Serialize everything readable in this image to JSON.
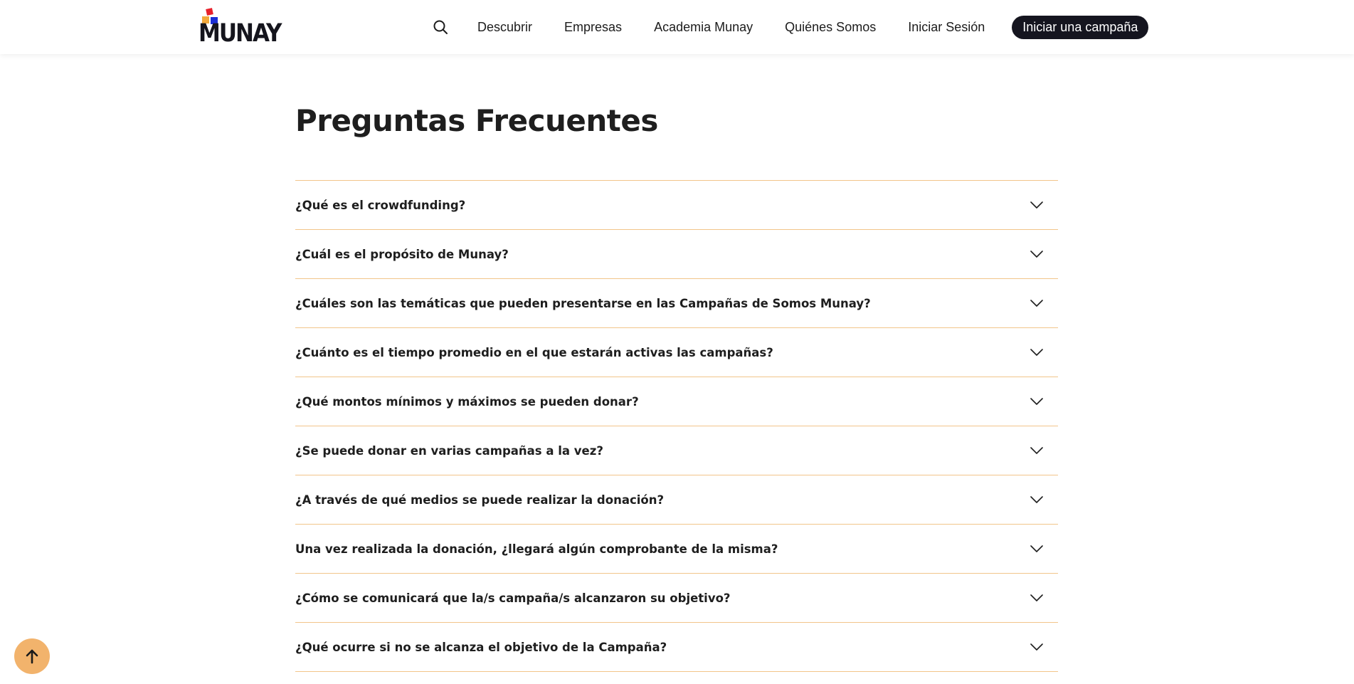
{
  "brand": {
    "logo_text": "MUNAY",
    "colors": {
      "accent_red": "#e8212b",
      "accent_orange": "#f2a93b",
      "accent_blue": "#1b2fd6",
      "divider": "#f2c58a",
      "dark": "#15151f"
    }
  },
  "nav": {
    "search_icon": "search-icon",
    "links": [
      "Descubrir",
      "Empresas",
      "Academia Munay",
      "Quiénes Somos",
      "Iniciar Sesión"
    ],
    "cta_label": "Iniciar una campaña"
  },
  "faq": {
    "title": "Preguntas Frecuentes",
    "questions": [
      "¿Qué es el crowdfunding?",
      "¿Cuál es el propósito de Munay?",
      "¿Cuáles son las temáticas que pueden presentarse en las Campañas de Somos Munay?",
      "¿Cuánto es el tiempo promedio en el que estarán activas las campañas?",
      "¿Qué montos mínimos y máximos se pueden donar?",
      "¿Se puede donar en varias campañas a la vez?",
      "¿A través de qué medios se puede realizar la donación?",
      "Una vez realizada la donación, ¿llegará algún comprobante de la misma?",
      "¿Cómo se comunicará que la/s campaña/s alcanzaron su objetivo?",
      "¿Qué ocurre si no se alcanza el objetivo de la Campaña?"
    ]
  },
  "scroll_top": {
    "icon": "arrow-up-icon"
  }
}
